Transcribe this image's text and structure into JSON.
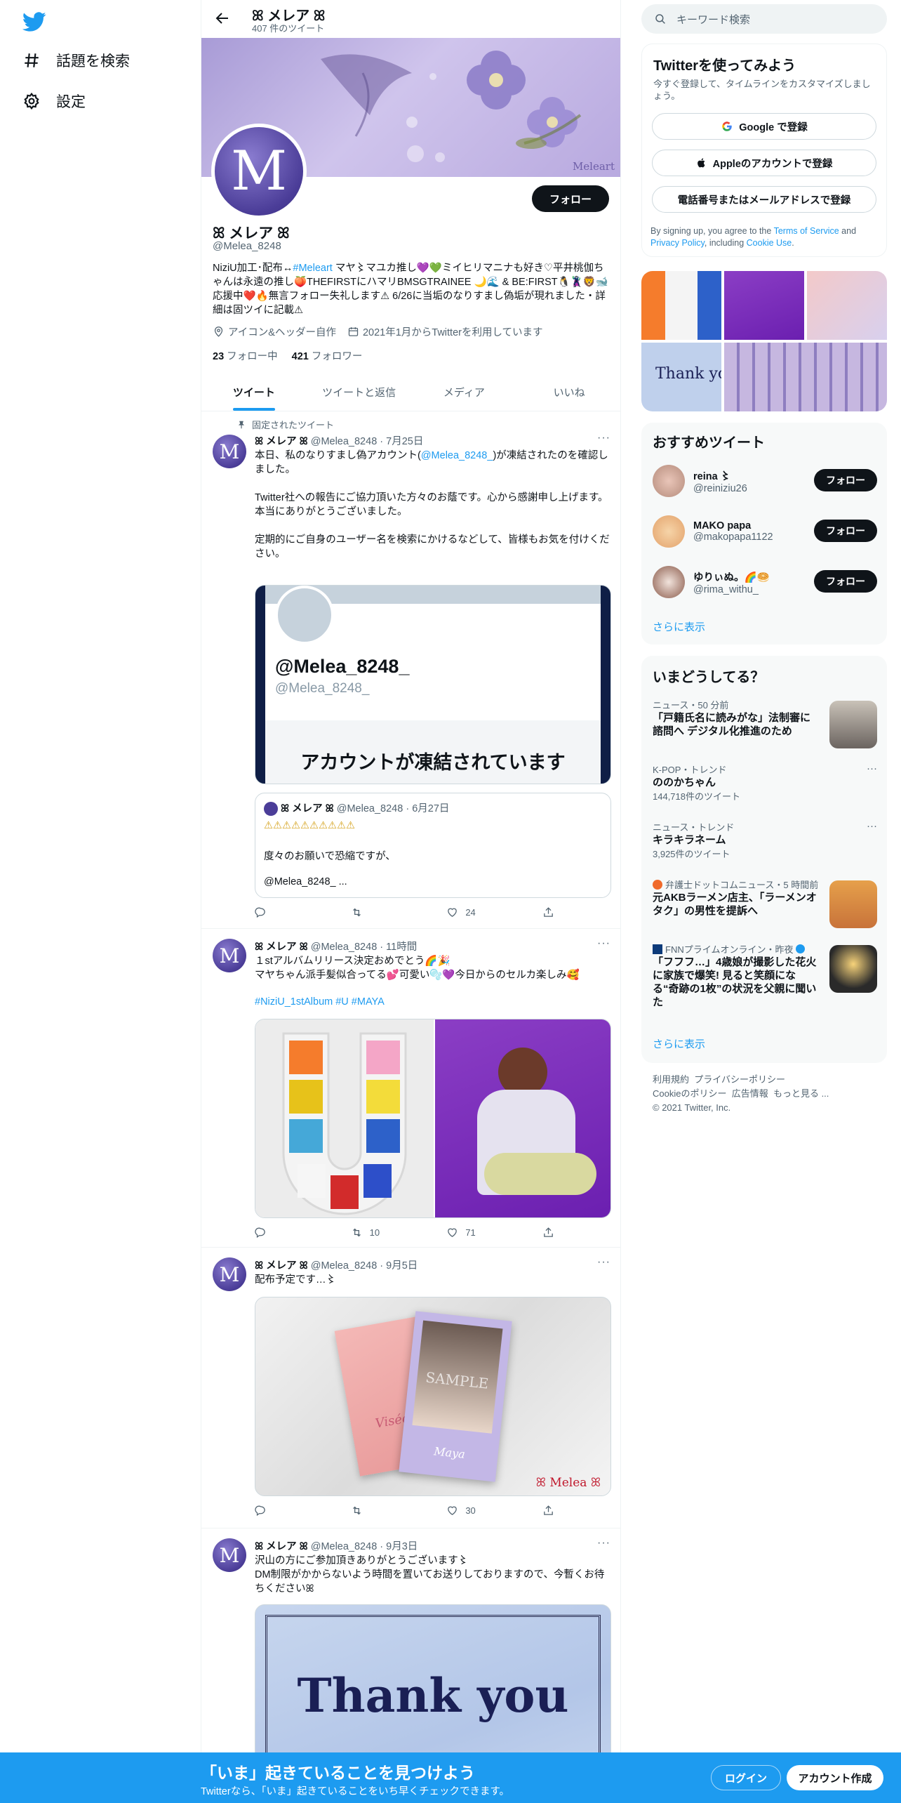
{
  "nav": {
    "explore_label": "話題を検索",
    "settings_label": "設定"
  },
  "profile_header": {
    "name": "ꕤ メレア ꕤ",
    "tweet_count": "407 件のツイート"
  },
  "banner": {
    "watermark": "Meleart"
  },
  "profile": {
    "avatar_letter": "M",
    "follow_label": "フォロー",
    "name": "ꕤ メレア ꕤ",
    "handle": "@Melea_8248",
    "bio_pre": "NiziU加工･配布↔",
    "bio_link": "#Meleart",
    "bio_post": " マヤ〻マユカ推し💜💚ミイヒリマニナも好き♡平井桃伽ちゃんは永遠の推し🍑THEFIRSTにハマリBMSGTRAINEE 🌙🌊 & BE:FIRST🐧🦹‍♂️🦁🐋応援中❤️🔥無言フォロー失礼します⚠ 6/26に当垢のなりすまし偽垢が現れました・詳細は固ツイに記載⚠",
    "location": "アイコン&ヘッダー自作",
    "joined": "2021年1月からTwitterを利用しています",
    "following_count": "23",
    "following_label": "フォロー中",
    "followers_count": "421",
    "followers_label": "フォロワー"
  },
  "tabs": [
    "ツイート",
    "ツイートと返信",
    "メディア",
    "いいね"
  ],
  "tweets": [
    {
      "pinned_label": "固定されたツイート",
      "name": "ꕤ メレア ꕤ",
      "handle": "@Melea_8248",
      "time": "7月25日",
      "text_pre": "本日、私のなりすまし偽アカウント(",
      "text_link": "@Melea_8248_",
      "text_post": ")が凍結されたのを確認しました。\n\nTwitter社への報告にご協力頂いた方々のお蔭です。心から感謝申し上げます。\n本当にありがとうございました。\n\n定期的にご自身のユーザー名を検索にかけるなどして、皆様もお気を付けください。",
      "card_display": "@Melea_8248_",
      "card_handle": "@Melea_8248_",
      "card_suspended": "アカウントが凍結されています",
      "quote_name": "ꕤ メレア ꕤ",
      "quote_handle": "@Melea_8248",
      "quote_time": "6月27日",
      "quote_line1": "⚠⚠⚠⚠⚠⚠⚠⚠⚠⚠",
      "quote_line2": "度々のお願いで恐縮ですが、",
      "quote_line3": "@Melea_8248_ ...",
      "replies": "",
      "retweets": "",
      "likes": "24"
    },
    {
      "name": "ꕤ メレア ꕤ",
      "handle": "@Melea_8248",
      "time": "11時間",
      "text": "１stアルバムリリース決定おめでとう🌈🎉\nマヤちゃん派手髪似合ってる💕可愛い🫧💜今日からのセルカ楽しみ🥰",
      "hashtags": "#NiziU_1stAlbum #U #MAYA",
      "replies": "",
      "retweets": "10",
      "likes": "71"
    },
    {
      "name": "ꕤ メレア ꕤ",
      "handle": "@Melea_8248",
      "time": "9月5日",
      "text": "配布予定です…〻",
      "watermark": "ꕤ Melea ꕤ",
      "sample": "SAMPLE",
      "card_left": "Visée",
      "card_right": "Maya",
      "replies": "",
      "retweets": "",
      "likes": "30"
    },
    {
      "name": "ꕤ メレア ꕤ",
      "handle": "@Melea_8248",
      "time": "9月3日",
      "text": "沢山の方にご参加頂きありがとうございます〻\nDM制限がかからないよう時間を置いてお送りしておりますので、今暫くお待ちくださいꕤ",
      "image_text": "Thank you"
    }
  ],
  "right": {
    "search_placeholder": "キーワード検索",
    "signup_title": "Twitterを使ってみよう",
    "signup_desc": "今すぐ登録して、タイムラインをカスタマイズしましょう。",
    "google_btn": "Google で登録",
    "apple_btn": "Appleのアカウントで登録",
    "phone_btn": "電話番号またはメールアドレスで登録",
    "terms_pre": "By signing up, you agree to the ",
    "terms_link": "Terms of Service",
    "terms_mid": " and ",
    "privacy_link": "Privacy Policy",
    "terms_mid2": ", including ",
    "cookie_link": "Cookie Use",
    "terms_end": ".",
    "grid_thankyou": "Thank yo",
    "whotofollow_title": "おすすめツイート",
    "follow_label": "フォロー",
    "suggestions": [
      {
        "name": "reina 〻",
        "handle": "@reiniziu26"
      },
      {
        "name": "MAKO papa",
        "handle": "@makopapa1122"
      },
      {
        "name": "ゆりぃぬ。🌈🥯",
        "handle": "@rima_withu_"
      }
    ],
    "show_more": "さらに表示",
    "trends_title": "いまどうしてる？",
    "trends": [
      {
        "context": "ニュース・50 分前",
        "title": "「戸籍氏名に読みがな」法制審に諮問へ デジタル化推進のため",
        "sub": ""
      },
      {
        "context": "K-POP・トレンド",
        "title": "ののかちゃん",
        "sub": "144,718件のツイート"
      },
      {
        "context": "ニュース・トレンド",
        "title": "キラキラネーム",
        "sub": "3,925件のツイート"
      },
      {
        "context": "弁護士ドットコムニュース・5 時間前",
        "title": "元AKBラーメン店主、「ラーメンオタク」の男性を提訴へ",
        "sub": ""
      },
      {
        "context": "FNNプライムオンライン・昨夜",
        "title": "「フフフ…」4歳娘が撮影した花火に家族で爆笑! 見ると笑顔になる“奇跡の1枚”の状況を父親に聞いた",
        "sub": ""
      }
    ],
    "show_more2": "さらに表示",
    "footer_links": [
      "利用規約",
      "プライバシーポリシー",
      "Cookieのポリシー",
      "広告情報",
      "もっと見る ..."
    ],
    "copyright": "© 2021 Twitter, Inc."
  },
  "bottom": {
    "title": "「いま」起きていることを見つけよう",
    "subtitle": "Twitterなら、「いま」起きていることをいち早くチェックできます。",
    "login": "ログイン",
    "signup": "アカウント作成"
  },
  "colors": {
    "accent": "#1d9bf0",
    "text": "#0f1419",
    "muted": "#536471"
  }
}
